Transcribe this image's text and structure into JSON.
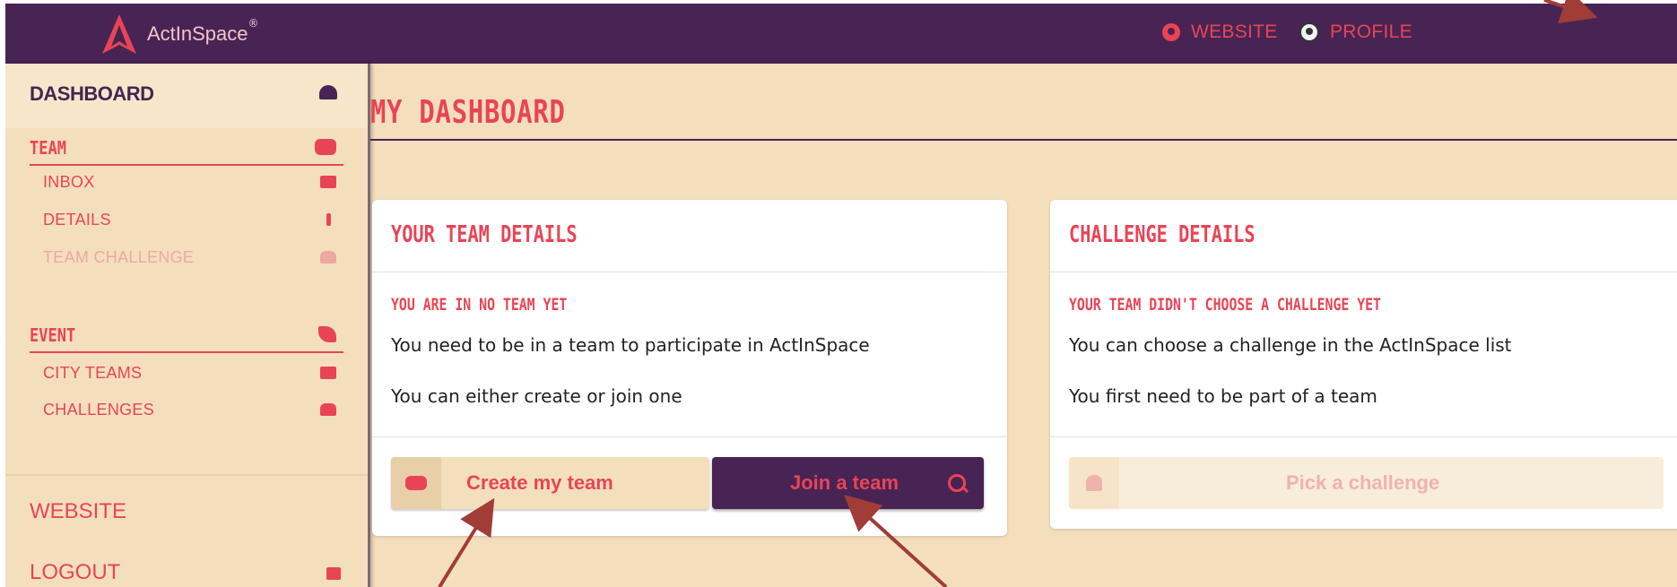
{
  "topbar": {
    "logo_text": "ActInSpace",
    "logo_reg": "®",
    "website_label": "WEBSITE",
    "profile_label": "PROFILE"
  },
  "sidebar": {
    "dashboard": "DASHBOARD",
    "team_section": "TEAM",
    "team_items": [
      {
        "label": "INBOX",
        "icon": "envelope-icon"
      },
      {
        "label": "DETAILS",
        "icon": "info-icon"
      },
      {
        "label": "TEAM CHALLENGE",
        "icon": "trophy-icon",
        "disabled": true
      }
    ],
    "event_section": "EVENT",
    "event_items": [
      {
        "label": "CITY TEAMS",
        "icon": "id-card-icon"
      },
      {
        "label": "CHALLENGES",
        "icon": "trophy-icon"
      }
    ],
    "website": "WEBSITE",
    "logout": "LOGOUT"
  },
  "main": {
    "title": "MY DASHBOARD",
    "team_card": {
      "title": "YOUR TEAM DETAILS",
      "subtitle": "YOU ARE IN NO TEAM YET",
      "line1": "You need to be in a team to participate in ActInSpace",
      "line2": "You can either create or join one",
      "create_button": "Create my team",
      "join_button": "Join a team"
    },
    "challenge_card": {
      "title": "CHALLENGE DETAILS",
      "subtitle": "YOUR TEAM DIDN'T CHOOSE A CHALLENGE YET",
      "line1": "You can choose a challenge in the ActInSpace list",
      "line2": "You first need to be part of a team",
      "pick_button": "Pick a challenge"
    }
  },
  "colors": {
    "primary": "#472454",
    "accent": "#e94456",
    "background": "#f4dfbd",
    "annotation_arrow": "#a13c36"
  }
}
